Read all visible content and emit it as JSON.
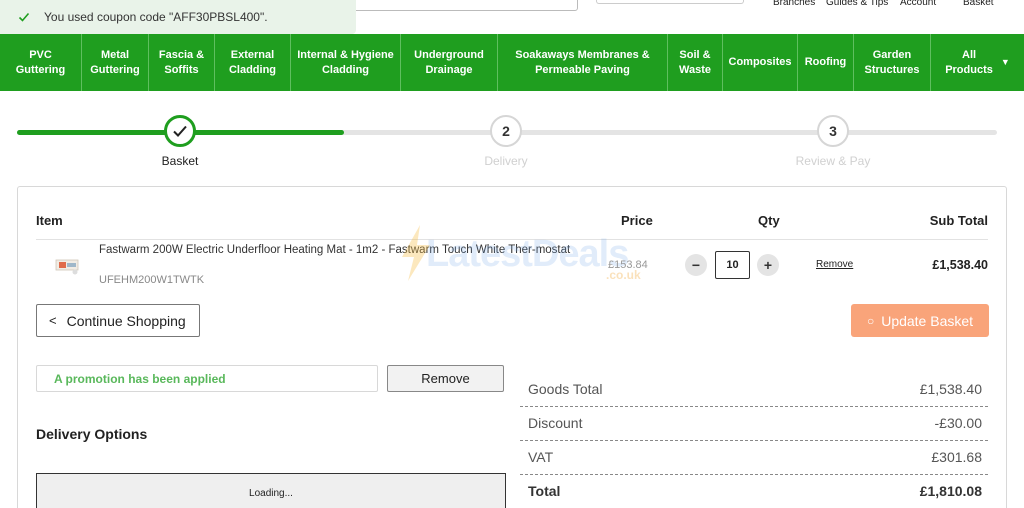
{
  "toast": {
    "message": "You used coupon code \"AFF30PBSL400\"."
  },
  "top_links": [
    "Branches",
    "Guides & Tips",
    "Account",
    "Basket"
  ],
  "nav": [
    {
      "label": "PVC\nGuttering"
    },
    {
      "label": "Metal\nGuttering"
    },
    {
      "label": "Fascia &\nSoffits"
    },
    {
      "label": "External\nCladding"
    },
    {
      "label": "Internal & Hygiene\nCladding"
    },
    {
      "label": "Underground\nDrainage"
    },
    {
      "label": "Soakaways Membranes &\nPermeable Paving"
    },
    {
      "label": "Soil &\nWaste"
    },
    {
      "label": "Composites"
    },
    {
      "label": "Roofing"
    },
    {
      "label": "Garden\nStructures"
    },
    {
      "label": "All\nProducts"
    }
  ],
  "steps": [
    {
      "number": "",
      "label": "Basket",
      "state": "done"
    },
    {
      "number": "2",
      "label": "Delivery",
      "state": "todo"
    },
    {
      "number": "3",
      "label": "Review & Pay",
      "state": "todo"
    }
  ],
  "progress_fraction": 0.33,
  "table": {
    "headers": {
      "item": "Item",
      "price": "Price",
      "qty": "Qty",
      "subtotal": "Sub Total"
    },
    "rows": [
      {
        "name": "Fastwarm 200W Electric Underfloor Heating Mat - 1m2 - Fastwarm Touch White Ther-mostat",
        "sku": "UFEHM200W1TWTK",
        "price": "£153.84",
        "qty": "10",
        "remove": "Remove",
        "subtotal": "£1,538.40"
      }
    ]
  },
  "watermark": {
    "text": "LatestDeals",
    "sub": ".co.uk"
  },
  "buttons": {
    "continue": "Continue Shopping",
    "update": "Update Basket",
    "promo_remove": "Remove",
    "minus": "−",
    "plus": "+"
  },
  "promo": {
    "message": "A promotion has been applied"
  },
  "delivery": {
    "title": "Delivery Options",
    "loading": "Loading..."
  },
  "totals": [
    {
      "label": "Goods Total",
      "value": "£1,538.40"
    },
    {
      "label": "Discount",
      "value": "-£30.00"
    },
    {
      "label": "VAT",
      "value": "£301.68"
    },
    {
      "label": "Total",
      "value": "£1,810.08"
    }
  ],
  "colors": {
    "brand_green": "#1f9e1f",
    "update_orange": "#f9a47a",
    "promo_green": "#59b85b"
  }
}
